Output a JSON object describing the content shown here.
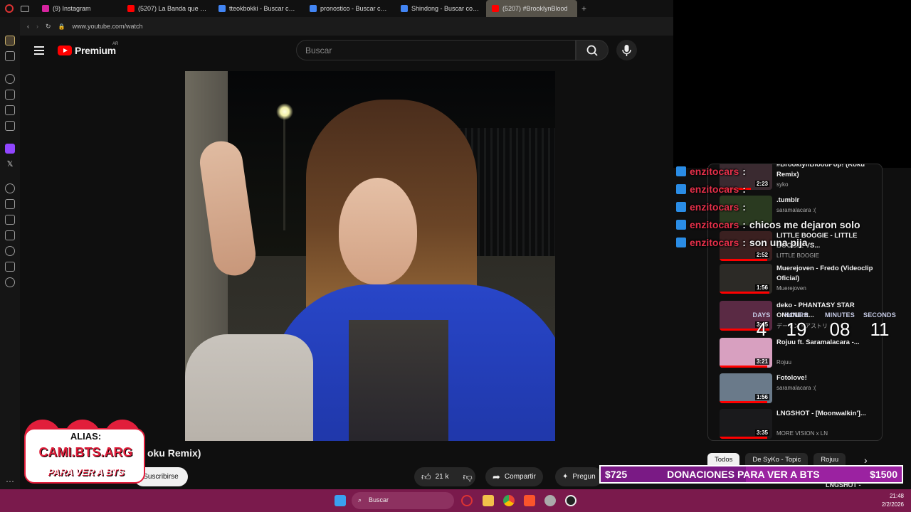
{
  "browser": {
    "tabs": [
      {
        "title": "(9) Instagram",
        "favicon_color": "#d6249f"
      },
      {
        "title": "(5207) La Banda que LOG",
        "favicon_color": "#ff0000"
      },
      {
        "title": "tteokbokki - Buscar con G",
        "favicon_color": "#4285f4"
      },
      {
        "title": "pronostico - Buscar con G",
        "favicon_color": "#4285f4"
      },
      {
        "title": "Shindong - Buscar con Go",
        "favicon_color": "#4285f4"
      },
      {
        "title": "(5207) #BrooklynBlood",
        "favicon_color": "#ff0000"
      }
    ],
    "new_tab": "+",
    "url": "www.youtube.com/watch"
  },
  "youtube": {
    "brand": "Premium",
    "country": "AR",
    "search_placeholder": "Buscar",
    "video_title_partial": "oku Remix)",
    "subscribe_label": "Suscribirse",
    "likes": "21 k",
    "share_label": "Compartir",
    "ask_label": "Pregun"
  },
  "recommended": [
    {
      "title": "#BrooklynBloodPop! (Roku Remix)",
      "channel": "syko",
      "duration": "2:23",
      "progress": 0.6,
      "thumb": "#3a2a30"
    },
    {
      "title": ".tumblr",
      "channel": "saramalacara :(",
      "duration": "",
      "progress": 0.0,
      "thumb": "#2a3a20"
    },
    {
      "title": "LITTLE BOOGIE - LITTLE BOOGIE VS...",
      "channel": "LITTLE BOOGIE",
      "duration": "2:52",
      "progress": 0.9,
      "thumb": "#3a2020"
    },
    {
      "title": "Muerejoven - Fredo (Videoclip Oficial)",
      "channel": "Muerejoven",
      "duration": "1:56",
      "progress": 0.95,
      "thumb": "#2c2a26"
    },
    {
      "title": "deko - PHANTASY STAR ONLINE ft...",
      "channel": "デーモン・アストリ",
      "duration": "3:45",
      "progress": 0.95,
      "thumb": "#5a2a44"
    },
    {
      "title": "Rojuu ft. Saramalacara -...",
      "channel": "Rojuu",
      "duration": "3:21",
      "progress": 0.9,
      "thumb": "#d8a0c0"
    },
    {
      "title": "Fotolove!",
      "channel": "saramalacara :(",
      "duration": "1:56",
      "progress": 0.9,
      "thumb": "#6a7a8a"
    },
    {
      "title": "LNGSHOT - [Moonwalkin']...",
      "channel": "MORE VISION x LN",
      "duration": "3:35",
      "progress": 0.9,
      "thumb": "#1a1a1c"
    }
  ],
  "chips": [
    "Todos",
    "De SyKo - Topic",
    "Rojuu"
  ],
  "chat": [
    {
      "user": "enzitocars",
      "message": ""
    },
    {
      "user": "enzitocars",
      "message": ""
    },
    {
      "user": "enzitocars",
      "message": ""
    },
    {
      "user": "enzitocars",
      "message": "chicos me dejaron solo"
    },
    {
      "user": "enzitocars",
      "message": "son una pija"
    }
  ],
  "chat_separator": " : ",
  "countdown": {
    "labels": [
      "DAYS",
      "HOURS",
      "MINUTES",
      "SECONDS"
    ],
    "values": [
      "4",
      "19",
      "08",
      "11"
    ]
  },
  "donation": {
    "current": "$725",
    "label": "DONACIONES PARA VER A BTS",
    "goal": "$1500",
    "progress": 0.483
  },
  "under_donation_text": "LNGSHOT -",
  "stream_logo": {
    "alias": "ALIAS:",
    "name": "CAMI.BTS.ARG",
    "slogan": "PARA VER A BTS"
  },
  "taskbar": {
    "search": "Buscar",
    "time": "21:48",
    "date": "2/2/2026"
  },
  "colors": {
    "youtube_red": "#ff0000",
    "chat_user": "#e5304a",
    "donation_bar": "#9b22a1",
    "taskbar": "#7a1a4c"
  }
}
